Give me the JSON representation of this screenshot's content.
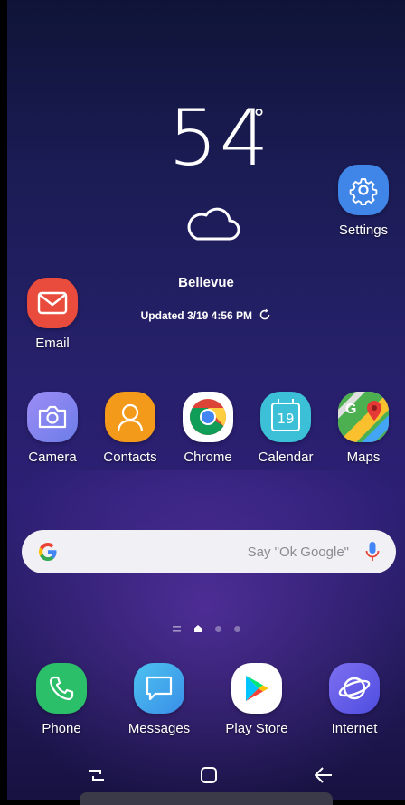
{
  "weather": {
    "temperature": "54",
    "degree_symbol": "°",
    "city": "Bellevue",
    "updated": "Updated 3/19 4:56 PM"
  },
  "apps": {
    "settings": "Settings",
    "email": "Email",
    "camera": "Camera",
    "contacts": "Contacts",
    "chrome": "Chrome",
    "calendar": "Calendar",
    "calendar_day": "19",
    "maps": "Maps"
  },
  "search": {
    "logo": "G",
    "placeholder": "Say \"Ok Google\""
  },
  "dock": {
    "phone": "Phone",
    "messages": "Messages",
    "play_store": "Play Store",
    "internet": "Internet"
  },
  "colors": {
    "settings": "#3f86e8",
    "email": "#e94b3c",
    "camera": "#8a7ff0",
    "contacts": "#f39a1b",
    "calendar": "#3cc0d8",
    "phone": "#2bbf6a",
    "messages": "#35a6e8",
    "internet": "#6a62e8"
  }
}
